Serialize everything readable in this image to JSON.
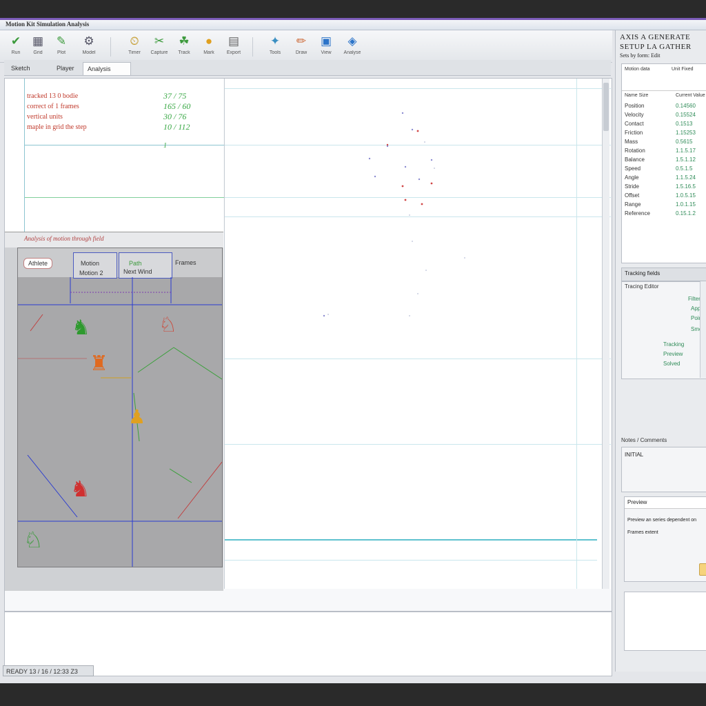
{
  "window": {
    "title": "Motion Kit Simulation Analysis"
  },
  "toolbar": {
    "buttons": [
      {
        "label": "Run",
        "icon": "check-icon"
      },
      {
        "label": "Grid",
        "icon": "grid-icon"
      },
      {
        "label": "Plot",
        "icon": "plot-icon"
      },
      {
        "label": "Model",
        "icon": "model-icon"
      },
      {
        "label": "Timer",
        "icon": "timer-icon"
      },
      {
        "label": "Capture",
        "icon": "capture-icon"
      },
      {
        "label": "Track",
        "icon": "track-icon"
      },
      {
        "label": "Mark",
        "icon": "mark-icon"
      },
      {
        "label": "Export",
        "icon": "export-icon"
      },
      {
        "label": "Tools",
        "icon": "tools-icon"
      },
      {
        "label": "Draw",
        "icon": "pen-icon"
      },
      {
        "label": "View",
        "icon": "view-icon"
      },
      {
        "label": "Analyse",
        "icon": "analyse-icon"
      }
    ]
  },
  "tabs": [
    {
      "label": "Sketch"
    },
    {
      "label": "Player"
    },
    {
      "label": "Analysis"
    }
  ],
  "info": {
    "rows": [
      {
        "label": "tracked 13 0 bodie",
        "value": "37 / 75"
      },
      {
        "label": "correct of 1 frames",
        "value": "165 / 60"
      },
      {
        "label": "vertical units",
        "value": "30 / 76"
      },
      {
        "label": "maple in grid the step",
        "value": "10 / 112"
      }
    ],
    "marker": "1"
  },
  "scene": {
    "header": "Analysis of motion through field",
    "tabs": {
      "left": "Athlete",
      "mid_top": "Motion",
      "mid_bottom": "Motion 2",
      "right_top": "Path",
      "right_bottom": "Next Wind",
      "far": "Frames"
    }
  },
  "statusbar": {
    "text": "READY 13 / 16 / 12:33 Z3"
  },
  "rightpanel": {
    "title": "AXIS A GENERATE",
    "subtitle": "SETUP LA GATHER",
    "caption": "Sets by form: Edit",
    "header_left": "Motion data",
    "header_right": "Unit Fixed",
    "columns": {
      "key": "Name Size",
      "value": "Current Value"
    },
    "properties": [
      {
        "key": "Position",
        "value": "0.14560"
      },
      {
        "key": "Velocity",
        "value": "0.15524"
      },
      {
        "key": "Contact",
        "value": "0.1513"
      },
      {
        "key": "Friction",
        "value": "1.15253"
      },
      {
        "key": "Mass",
        "value": "0.5615"
      },
      {
        "key": "Rotation",
        "value": "1.1.5.17"
      },
      {
        "key": "Balance",
        "value": "1.5.1.12"
      },
      {
        "key": "Speed",
        "value": "0.5.1.5"
      },
      {
        "key": "Angle",
        "value": "1.1.5.24"
      },
      {
        "key": "Stride",
        "value": "1.5.16.5"
      },
      {
        "key": "Offset",
        "value": "1.0.5.15"
      },
      {
        "key": "Range",
        "value": "1.0.1.15"
      },
      {
        "key": "Reference",
        "value": "0.15.1.2"
      }
    ],
    "events_title": "Tracking fields",
    "events_header": "Tracing Editor",
    "events": [
      "Filter",
      "Apply",
      "Points",
      "Smooth",
      "Tracking",
      "Preview",
      "Solved"
    ],
    "notes_title": "Notes / Comments",
    "notes_text": "INITIAL",
    "preview_title": "Preview",
    "preview_line1": "Preview an series dependent on",
    "preview_line2": "Frames extent"
  },
  "colors": {
    "accent": "#7b5bb8",
    "label_red": "#c0392b",
    "value_green": "#39a845",
    "gridline": "#c9e6ec"
  }
}
